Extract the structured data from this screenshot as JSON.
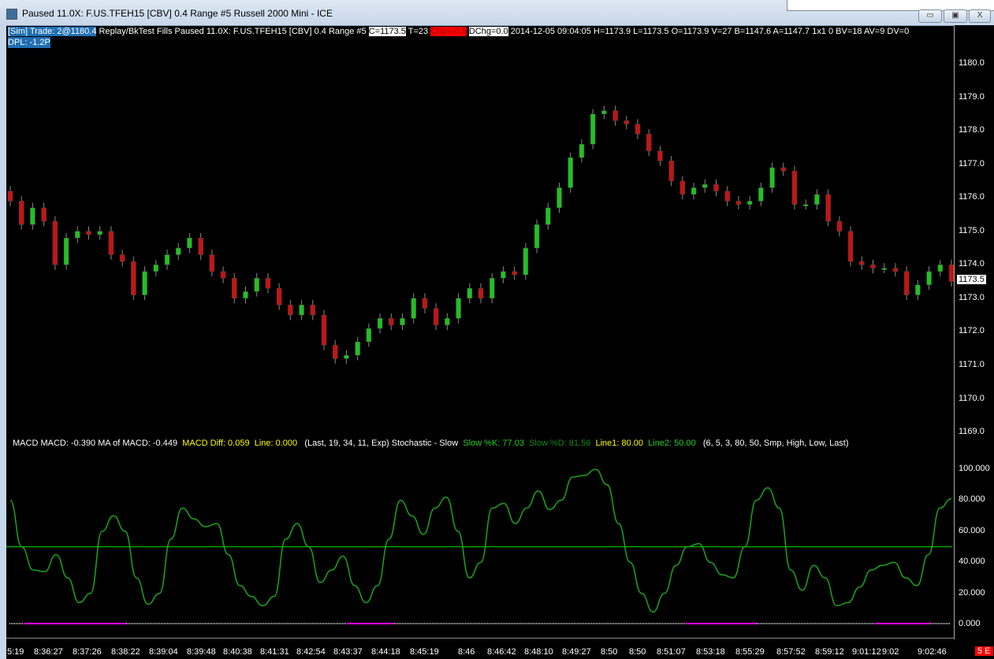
{
  "window": {
    "title": "Paused 11.0X: F.US.TFEH15 [CBV]  0.4 Range  #5  Russell 2000 Mini - ICE",
    "min": "▭",
    "max": "▣",
    "close": "X"
  },
  "info": {
    "sim_trade": "[Sim]  Trade: 2@1180.4",
    "replay": " Replay/BkTest Fills  Paused 11.0X: F.US.TFEH15 [CBV]  0.4 Range  #5 ",
    "close": "C=1173.5",
    "ticks": " T=23 ",
    "chg": "Chg=-0.5",
    "dchg": "DChg=0.0",
    "rest": " 2014-12-05 09:04:05 H=1173.9 L=1173.5 O=1173.9 V=27 B=1147.6 A=1147.7 1x1 0 BV=18 AV=9 DV=0",
    "dpl": "DPL: -1.2P"
  },
  "price_axis": {
    "ticks": [
      "1180.0",
      "1179.0",
      "1178.0",
      "1177.0",
      "1176.0",
      "1175.0",
      "1174.0",
      "1173.0",
      "1172.0",
      "1171.0",
      "1170.0",
      "1169.0"
    ],
    "last_price": "1173.5"
  },
  "indicator": {
    "macd": "MACD  MACD: -0.390  MA of MACD: -0.449",
    "macd_diff": "MACD Diff: 0.059",
    "line": "Line: 0.000",
    "macd_params": "(Last, 19, 34, 11, Exp)  Stochastic - Slow",
    "slow_k": "Slow %K: 77.03",
    "slow_d": "Slow %D: 81.56",
    "line1": "Line1: 80.00",
    "line2": "Line2: 50.00",
    "stoch_params": "(6, 5, 3, 80, 50, Smp, High, Low, Last)",
    "axis_ticks": [
      "100.000",
      "80.000",
      "60.000",
      "40.000",
      "20.000",
      "0.000"
    ]
  },
  "time_axis": [
    "5:19",
    "8:36:27",
    "8:37:26",
    "8:38:22",
    "8:39:04",
    "8:39:48",
    "8:40:38",
    "8:41:31",
    "8:42:54",
    "8:43:37",
    "8:44:18",
    "8:45:19",
    "8:46",
    "8:46:42",
    "8:48:10",
    "8:49:27",
    "8:50",
    "8:50",
    "8:51:07",
    "8:53:18",
    "8:55:29",
    "8:57:52",
    "8:59:12",
    "9:01:12",
    "9:02",
    "9:02:46"
  ],
  "status_badge": "5 E",
  "colors": {
    "up": "#22c122",
    "down": "#c41414",
    "stoch": "#1aa51a",
    "line2": "#00d000",
    "macd": "#ff00ff"
  },
  "chart_data": {
    "type": "candlestick",
    "closes": [
      1175.9,
      1175.2,
      1175.7,
      1175.3,
      1174.0,
      1174.8,
      1175.0,
      1174.9,
      1175.0,
      1174.3,
      1174.1,
      1173.1,
      1173.8,
      1174.0,
      1174.3,
      1174.5,
      1174.8,
      1174.3,
      1173.8,
      1173.6,
      1173.0,
      1173.2,
      1173.6,
      1173.3,
      1172.8,
      1172.5,
      1172.8,
      1172.5,
      1171.6,
      1171.2,
      1171.3,
      1171.7,
      1172.1,
      1172.4,
      1172.2,
      1172.4,
      1173.0,
      1172.7,
      1172.2,
      1172.4,
      1173.0,
      1173.3,
      1173.0,
      1173.6,
      1173.8,
      1173.7,
      1174.5,
      1175.2,
      1175.7,
      1176.3,
      1177.2,
      1177.6,
      1178.5,
      1178.6,
      1178.3,
      1178.2,
      1177.9,
      1177.4,
      1177.1,
      1176.5,
      1176.1,
      1176.3,
      1176.4,
      1176.2,
      1175.9,
      1175.8,
      1175.9,
      1176.3,
      1176.9,
      1176.8,
      1175.8,
      1175.8,
      1176.1,
      1175.3,
      1175.0,
      1174.1,
      1174.0,
      1173.9,
      1173.9,
      1173.8,
      1173.1,
      1173.4,
      1173.8,
      1174.0,
      1173.5
    ],
    "ylim": [
      1169,
      1180.6
    ],
    "stochastic_k": [
      80,
      50,
      35,
      34,
      45,
      30,
      14,
      20,
      60,
      70,
      60,
      30,
      13,
      20,
      55,
      75,
      68,
      63,
      65,
      45,
      25,
      18,
      12,
      18,
      55,
      65,
      50,
      27,
      35,
      44,
      25,
      14,
      25,
      55,
      80,
      70,
      58,
      75,
      82,
      60,
      30,
      40,
      75,
      78,
      65,
      75,
      86,
      74,
      80,
      95,
      96,
      100,
      90,
      65,
      40,
      20,
      8,
      20,
      38,
      50,
      52,
      40,
      32,
      30,
      50,
      80,
      88,
      75,
      35,
      22,
      38,
      30,
      12,
      14,
      24,
      35,
      38,
      40,
      30,
      25,
      45,
      75,
      81
    ],
    "stochastic_line2": 50,
    "stoch_ylim": [
      0,
      100
    ]
  }
}
